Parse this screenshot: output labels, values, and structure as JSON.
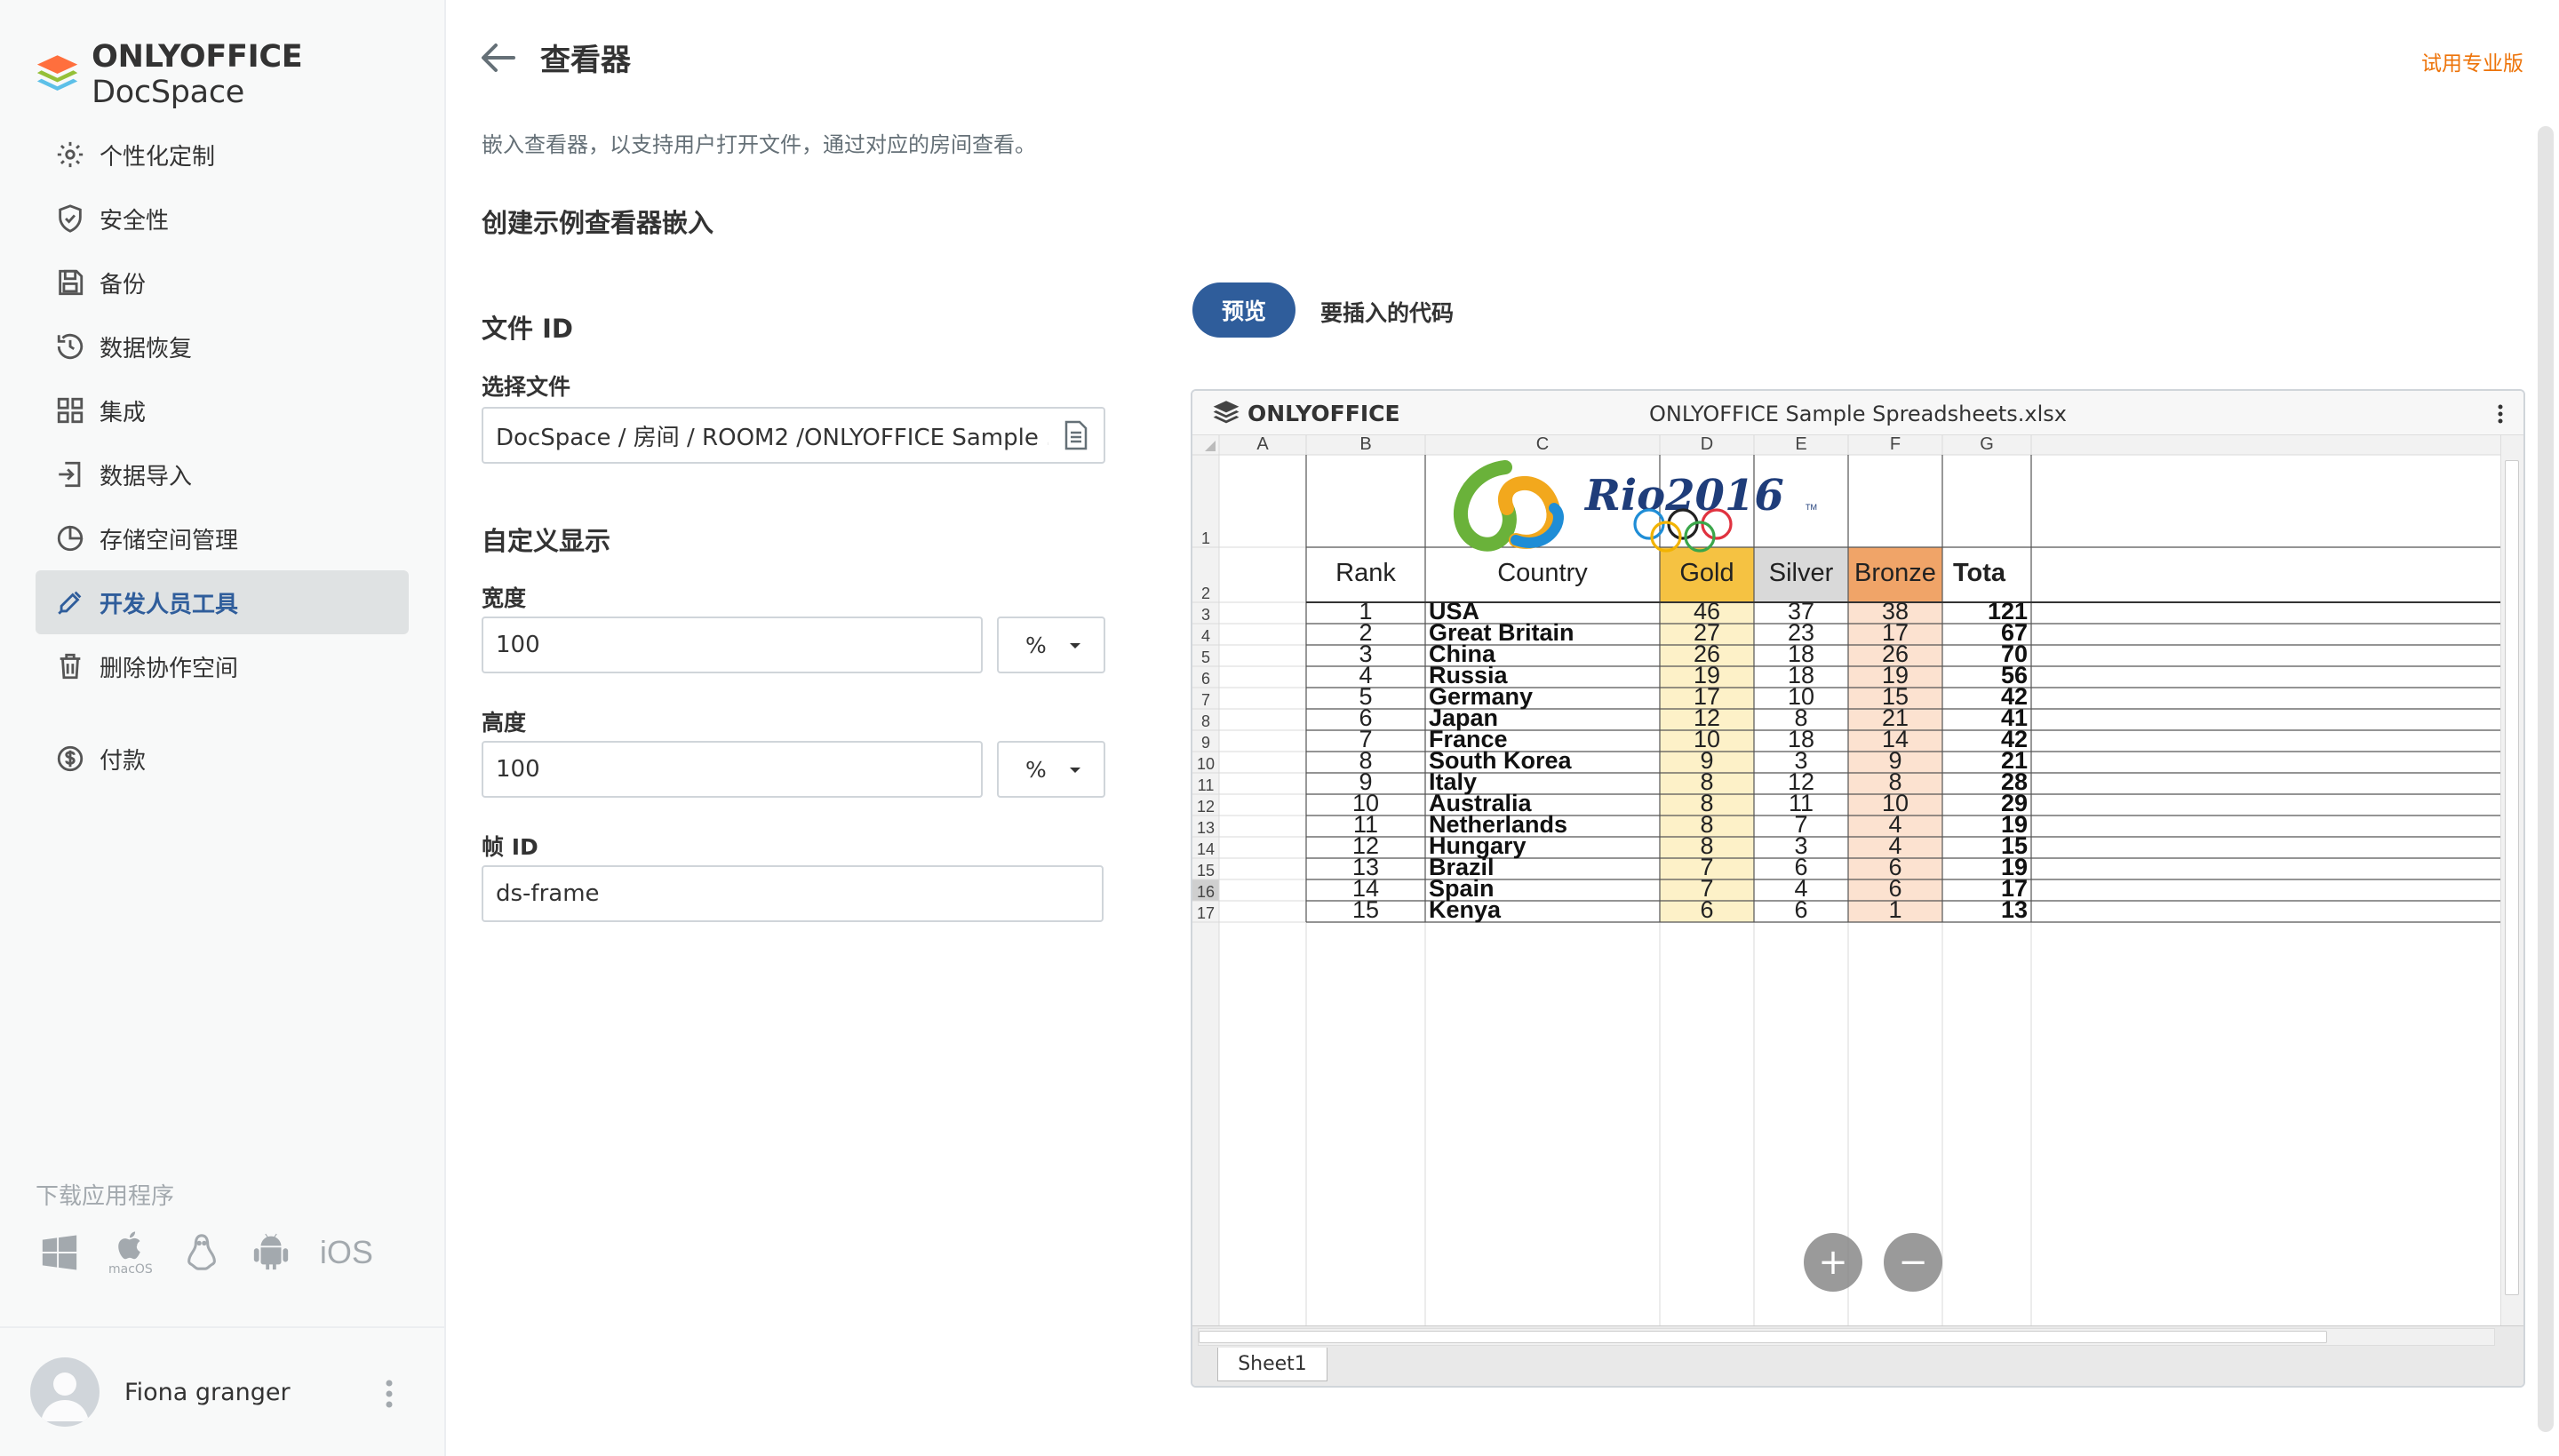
{
  "brand": {
    "name_bold": "ONLYOFFICE",
    "name_light": "DocSpace"
  },
  "sidebar": {
    "items": [
      {
        "label": "个性化定制",
        "icon": "gear-icon"
      },
      {
        "label": "安全性",
        "icon": "shield-icon"
      },
      {
        "label": "备份",
        "icon": "save-icon"
      },
      {
        "label": "数据恢复",
        "icon": "restore-icon"
      },
      {
        "label": "集成",
        "icon": "grid-icon"
      },
      {
        "label": "数据导入",
        "icon": "import-icon"
      },
      {
        "label": "存储空间管理",
        "icon": "pie-chart-icon"
      },
      {
        "label": "开发人员工具",
        "icon": "tools-icon",
        "active": true
      },
      {
        "label": "删除协作空间",
        "icon": "trash-icon"
      }
    ],
    "payment": {
      "label": "付款",
      "icon": "dollar-icon"
    },
    "download_title": "下载应用程序",
    "download_apps": [
      "windows-icon",
      "macos-icon",
      "linux-icon",
      "android-icon",
      "ios-icon"
    ],
    "macos_label": "macOS",
    "ios_label": "iOS"
  },
  "user": {
    "name": "Fiona granger"
  },
  "header": {
    "title": "查看器",
    "upgrade": "试用专业版"
  },
  "description": "嵌入查看器，以支持用户打开文件，通过对应的房间查看。",
  "form": {
    "section_title": "创建示例查看器嵌入",
    "file_id_title": "文件 ID",
    "select_file_label": "选择文件",
    "select_file_value": "DocSpace / 房间 / ROOM2 /ONLYOFFICE Sample ...",
    "custom_display_title": "自定义显示",
    "width_label": "宽度",
    "width_value": "100",
    "width_unit": "%",
    "height_label": "高度",
    "height_value": "100",
    "height_unit": "%",
    "frame_id_label": "帧 ID",
    "frame_id_value": "ds-frame"
  },
  "tabs": {
    "preview": "预览",
    "code": "要插入的代码"
  },
  "viewer": {
    "brand": "ONLYOFFICE",
    "file_title": "ONLYOFFICE Sample Spreadsheets.xlsx",
    "sheet_tab": "Sheet1",
    "columns": [
      "A",
      "B",
      "C",
      "D",
      "E",
      "F",
      "G"
    ],
    "header_row": {
      "rank": "Rank",
      "country": "Country",
      "gold": "Gold",
      "silver": "Silver",
      "bronze": "Bronze",
      "total": "Tota"
    },
    "logo_text": "Rio2016",
    "logo_tm": "TM",
    "rows": [
      {
        "rank": "1",
        "country": "USA",
        "gold": "46",
        "silver": "37",
        "bronze": "38",
        "total": "121"
      },
      {
        "rank": "2",
        "country": "Great Britain",
        "gold": "27",
        "silver": "23",
        "bronze": "17",
        "total": "67"
      },
      {
        "rank": "3",
        "country": "China",
        "gold": "26",
        "silver": "18",
        "bronze": "26",
        "total": "70"
      },
      {
        "rank": "4",
        "country": "Russia",
        "gold": "19",
        "silver": "18",
        "bronze": "19",
        "total": "56"
      },
      {
        "rank": "5",
        "country": "Germany",
        "gold": "17",
        "silver": "10",
        "bronze": "15",
        "total": "42"
      },
      {
        "rank": "6",
        "country": "Japan",
        "gold": "12",
        "silver": "8",
        "bronze": "21",
        "total": "41"
      },
      {
        "rank": "7",
        "country": "France",
        "gold": "10",
        "silver": "18",
        "bronze": "14",
        "total": "42"
      },
      {
        "rank": "8",
        "country": "South Korea",
        "gold": "9",
        "silver": "3",
        "bronze": "9",
        "total": "21"
      },
      {
        "rank": "9",
        "country": "Italy",
        "gold": "8",
        "silver": "12",
        "bronze": "8",
        "total": "28"
      },
      {
        "rank": "10",
        "country": "Australia",
        "gold": "8",
        "silver": "11",
        "bronze": "10",
        "total": "29"
      },
      {
        "rank": "11",
        "country": "Netherlands",
        "gold": "8",
        "silver": "7",
        "bronze": "4",
        "total": "19"
      },
      {
        "rank": "12",
        "country": "Hungary",
        "gold": "8",
        "silver": "3",
        "bronze": "4",
        "total": "15"
      },
      {
        "rank": "13",
        "country": "Brazil",
        "gold": "7",
        "silver": "6",
        "bronze": "6",
        "total": "19"
      },
      {
        "rank": "14",
        "country": "Spain",
        "gold": "7",
        "silver": "4",
        "bronze": "6",
        "total": "17"
      },
      {
        "rank": "15",
        "country": "Kenya",
        "gold": "6",
        "silver": "6",
        "bronze": "1",
        "total": "13"
      }
    ],
    "row_numbers": [
      "1",
      "2",
      "3",
      "4",
      "5",
      "6",
      "7",
      "8",
      "9",
      "10",
      "11",
      "12",
      "13",
      "14",
      "15",
      "16",
      "17"
    ],
    "selected_row": "16",
    "zoom_in": "+",
    "zoom_out": "−"
  },
  "colors": {
    "accent_blue": "#2f5d9b",
    "upgrade_orange": "#ed7309",
    "gold_header": "#f5c242",
    "gold_cell": "#fdf1c8",
    "silver_header": "#d9d9d9",
    "bronze_header": "#f0a468",
    "bronze_cell": "#fce2d0"
  }
}
